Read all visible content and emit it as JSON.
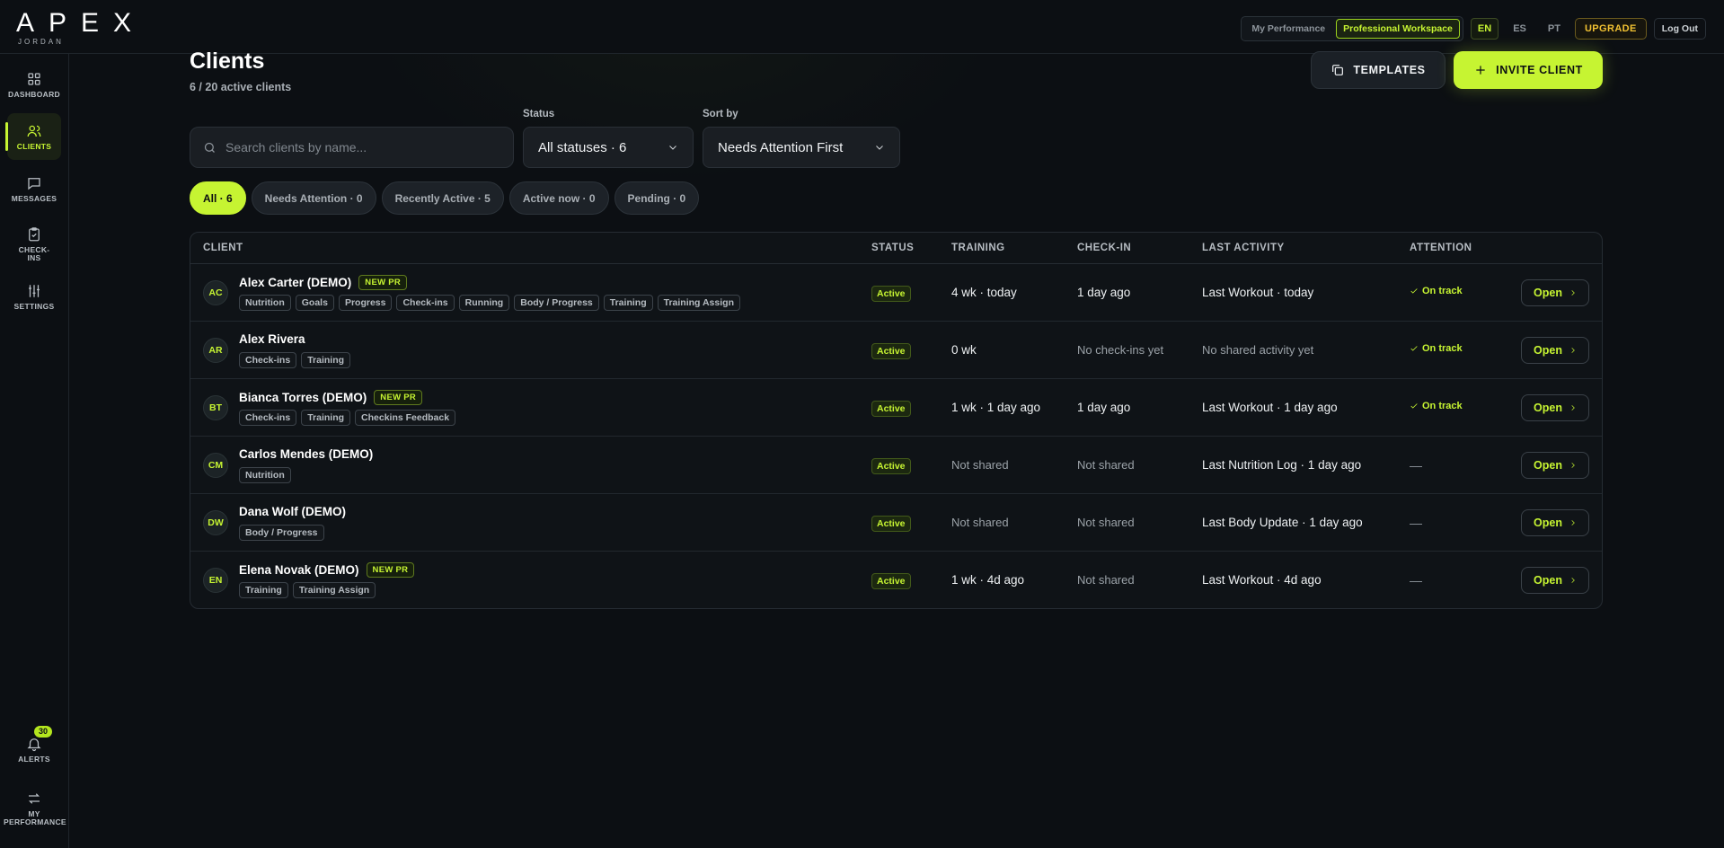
{
  "brand": {
    "logo": "APEX",
    "sub": "JORDAN"
  },
  "topbar": {
    "modes": [
      "My Performance",
      "Professional Workspace"
    ],
    "languages": [
      "EN",
      "ES",
      "PT"
    ],
    "upgrade": "UPGRADE",
    "logout": "Log Out"
  },
  "sidebar": {
    "items": [
      {
        "label": "DASHBOARD",
        "icon": "grid-icon"
      },
      {
        "label": "CLIENTS",
        "icon": "users-icon"
      },
      {
        "label": "MESSAGES",
        "icon": "message-icon"
      },
      {
        "label": "CHECK-INS",
        "icon": "clipboard-icon"
      },
      {
        "label": "SETTINGS",
        "icon": "sliders-icon"
      }
    ],
    "alerts": {
      "label": "ALERTS",
      "count": "30"
    },
    "switch": {
      "label": "MY PERFORMANCE"
    }
  },
  "page": {
    "title": "Clients",
    "subtitle": "6 / 20 active clients",
    "templates_label": "TEMPLATES",
    "invite_label": "INVITE CLIENT"
  },
  "filters": {
    "search_placeholder": "Search clients by name...",
    "status_label": "Status",
    "status_value": "All statuses · 6",
    "sort_label": "Sort by",
    "sort_value": "Needs Attention First",
    "pills": [
      "All · 6",
      "Needs Attention · 0",
      "Recently Active · 5",
      "Active now · 0",
      "Pending · 0"
    ]
  },
  "table": {
    "headers": [
      "CLIENT",
      "STATUS",
      "TRAINING",
      "CHECK-IN",
      "LAST ACTIVITY",
      "ATTENTION"
    ],
    "open_label": "Open",
    "rows": [
      {
        "initials": "AC",
        "name": "Alex Carter (DEMO)",
        "new_pr": "NEW PR",
        "tags": [
          "Nutrition",
          "Goals",
          "Progress",
          "Check-ins",
          "Running",
          "Body / Progress",
          "Training",
          "Training Assign"
        ],
        "status": "Active",
        "training": "4 wk · today",
        "checkin": "1 day ago",
        "activity": "Last Workout · today",
        "attention": "On track"
      },
      {
        "initials": "AR",
        "name": "Alex Rivera",
        "new_pr": "",
        "tags": [
          "Check-ins",
          "Training"
        ],
        "status": "Active",
        "training": "0 wk",
        "checkin": "No check-ins yet",
        "activity": "No shared activity yet",
        "attention": "On track"
      },
      {
        "initials": "BT",
        "name": "Bianca Torres (DEMO)",
        "new_pr": "NEW PR",
        "tags": [
          "Check-ins",
          "Training",
          "Checkins Feedback"
        ],
        "status": "Active",
        "training": "1 wk · 1 day ago",
        "checkin": "1 day ago",
        "activity": "Last Workout · 1 day ago",
        "attention": "On track"
      },
      {
        "initials": "CM",
        "name": "Carlos Mendes (DEMO)",
        "new_pr": "",
        "tags": [
          "Nutrition"
        ],
        "status": "Active",
        "training": "Not shared",
        "checkin": "Not shared",
        "activity": "Last Nutrition Log · 1 day ago",
        "attention": "—"
      },
      {
        "initials": "DW",
        "name": "Dana Wolf (DEMO)",
        "new_pr": "",
        "tags": [
          "Body / Progress"
        ],
        "status": "Active",
        "training": "Not shared",
        "checkin": "Not shared",
        "activity": "Last Body Update · 1 day ago",
        "attention": "—"
      },
      {
        "initials": "EN",
        "name": "Elena Novak (DEMO)",
        "new_pr": "NEW PR",
        "tags": [
          "Training",
          "Training Assign"
        ],
        "status": "Active",
        "training": "1 wk · 4d ago",
        "checkin": "Not shared",
        "activity": "Last Workout · 4d ago",
        "attention": "—"
      }
    ]
  },
  "colors": {
    "accent": "#c6f432",
    "background": "#0c0f13",
    "upgrade": "#f2c232"
  }
}
